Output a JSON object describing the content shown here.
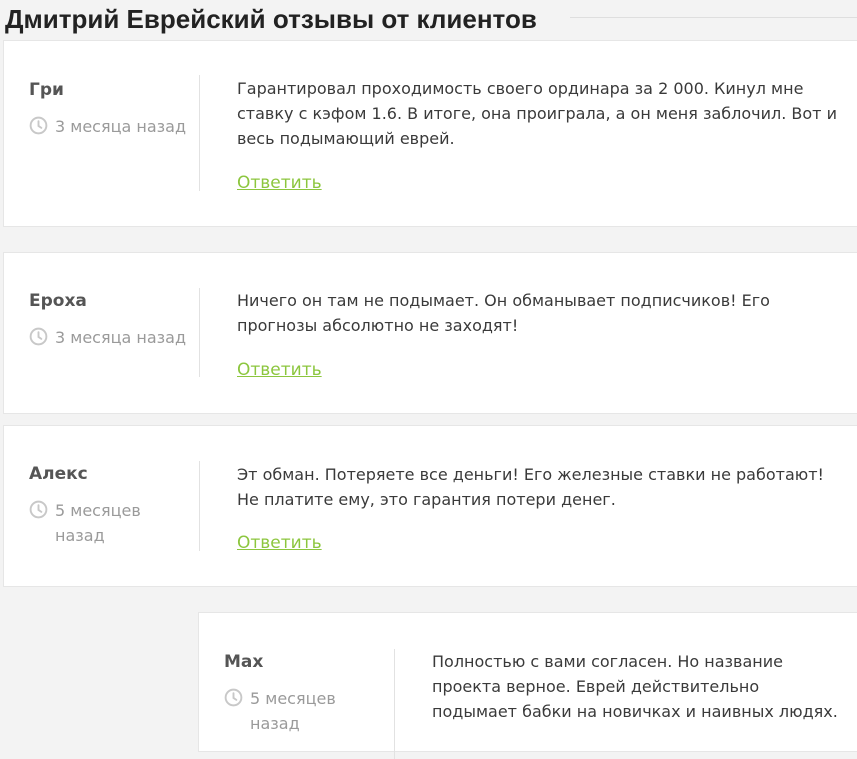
{
  "page": {
    "title": "Дмитрий Еврейский отзывы от клиентов"
  },
  "colors": {
    "accent": "#8cc63e",
    "text": "#3a3a3a",
    "muted": "#9a9a9a",
    "background": "#f3f3f3"
  },
  "icons": {
    "date": "clock-icon"
  },
  "comments": [
    {
      "author": "Гри",
      "date": "3 месяца назад",
      "text": "Гарантировал проходимость своего ординара за 2 000. Кинул мне ставку с кэфом 1.6. В итоге, она проиграла, а он меня заблочил. Вот и весь подымающий еврей.",
      "reply_label": "Ответить"
    },
    {
      "author": "Ероха",
      "date": "3 месяца назад",
      "text": "Ничего он там не подымает. Он обманывает подписчиков! Его прогнозы абсолютно не заходят!",
      "reply_label": "Ответить"
    },
    {
      "author": "Алекс",
      "date": "5 месяцев назад",
      "text": "Эт обман. Потеряете все деньги! Его железные ставки не работают! Не платите ему, это гарантия потери денег.",
      "reply_label": "Ответить"
    },
    {
      "author": "Max",
      "date": "5 месяцев назад",
      "text": "Полностью с вами согласен. Но название проекта верное. Еврей действительно подымает бабки на новичках и наивных людях.",
      "reply_label": ""
    }
  ]
}
